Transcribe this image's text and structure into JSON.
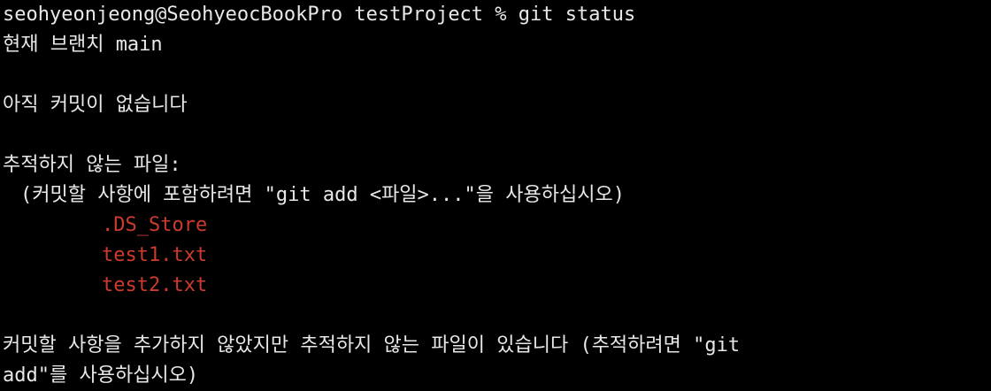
{
  "terminal": {
    "prompt": "seohyeonjeong@SeohyeocBookPro testProject % git status",
    "branch_line": "현재 브랜치 main",
    "no_commits": "아직 커밋이 없습니다",
    "untracked_header": "추적하지 않는 파일:",
    "untracked_hint": "(커밋할 사항에 포함하려면 \"git add <파일>...\"을 사용하십시오)",
    "untracked_files": [
      ".DS_Store",
      "test1.txt",
      "test2.txt"
    ],
    "summary_line_1": "커밋할 사항을 추가하지 않았지만 추적하지 않는 파일이 있습니다 (추적하려면 \"git",
    "summary_line_2": "add\"를 사용하십시오)",
    "colors": {
      "background": "#000000",
      "text": "#e8e8e8",
      "untracked": "#cc3b2e"
    }
  }
}
